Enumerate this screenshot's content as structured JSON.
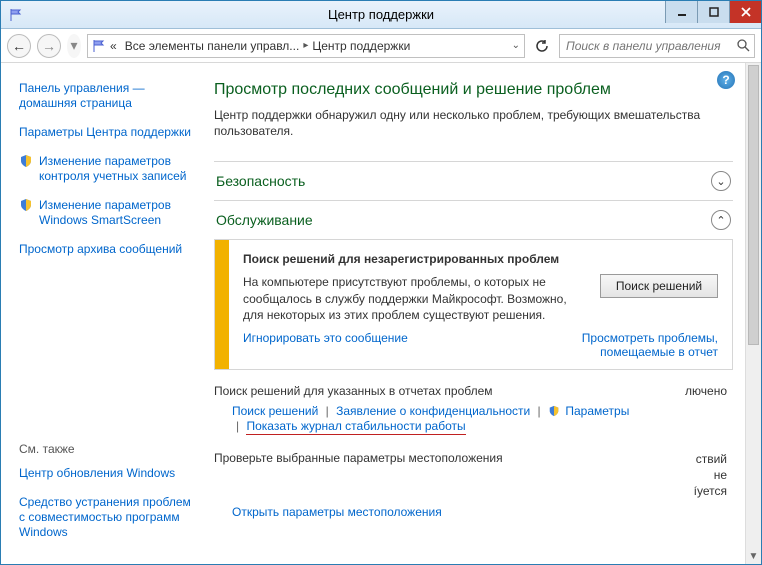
{
  "titlebar": {
    "title": "Центр поддержки"
  },
  "nav": {
    "crumb1": "Все элементы панели управл...",
    "crumb2": "Центр поддержки",
    "chevrons": "«",
    "search_placeholder": "Поиск в панели управления"
  },
  "sidebar": {
    "home": "Панель управления — домашняя страница",
    "settings": "Параметры Центра поддержки",
    "uac": "Изменение параметров контроля учетных записей",
    "smartscreen": "Изменение параметров Windows SmartScreen",
    "archive": "Просмотр архива сообщений",
    "seealso_h": "См. также",
    "wu": "Центр обновления Windows",
    "compat": "Средство устранения проблем с совместимостью программ Windows"
  },
  "main": {
    "heading": "Просмотр последних сообщений и решение проблем",
    "sub": "Центр поддержки обнаружил одну или несколько проблем, требующих вмешательства пользователя.",
    "security": "Безопасность",
    "maintenance": "Обслуживание",
    "panel": {
      "title": "Поиск решений для незарегистрированных проблем",
      "msg": "На компьютере присутствуют проблемы, о которых не сообщалось в службу поддержки Майкрософт. Возможно, для некоторых из этих проблем существуют решения.",
      "btn": "Поиск решений",
      "ignore": "Игнорировать это сообщение",
      "view": "Просмотреть проблемы, помещаемые в отчет"
    },
    "repsearch": {
      "label": "Поиск решений для указанных в отчетах проблем",
      "status": "лючено",
      "l1": "Поиск решений",
      "l2": "Заявление о конфиденциальности",
      "l3": "Параметры",
      "l4": "Показать журнал стабильности работы"
    },
    "loc": {
      "label": "Проверьте выбранные параметры местоположения",
      "r1": "ствий",
      "r2": "не",
      "r3": "íуется",
      "open": "Открыть параметры местоположения"
    }
  }
}
